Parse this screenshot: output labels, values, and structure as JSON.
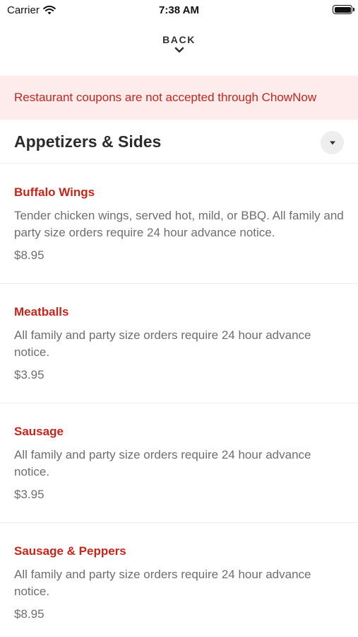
{
  "status_bar": {
    "carrier": "Carrier",
    "time": "7:38 AM",
    "icons": [
      "wifi-icon",
      "battery-icon"
    ]
  },
  "nav": {
    "back_label": "BACK",
    "back_icon": "chevron-down-icon"
  },
  "notice": {
    "text": "Restaurant coupons are not accepted through ChowNow"
  },
  "section": {
    "title": "Appetizers & Sides",
    "toggle_icon": "caret-down-icon"
  },
  "items": [
    {
      "name": "Buffalo Wings",
      "description": "Tender chicken wings, served hot, mild, or BBQ. All family and party size orders require 24 hour advance notice.",
      "price": "$8.95"
    },
    {
      "name": "Meatballs",
      "description": "All family and party size orders require 24 hour advance notice.",
      "price": "$3.95"
    },
    {
      "name": "Sausage",
      "description": "All family and party size orders require 24 hour advance notice.",
      "price": "$3.95"
    },
    {
      "name": "Sausage & Peppers",
      "description": "All family and party size orders require 24 hour advance notice.",
      "price": "$8.95"
    }
  ],
  "colors": {
    "accent": "#c8241b",
    "notice_background": "#fdeceb",
    "text_muted": "#6e6e6e",
    "divider": "#ececec"
  }
}
